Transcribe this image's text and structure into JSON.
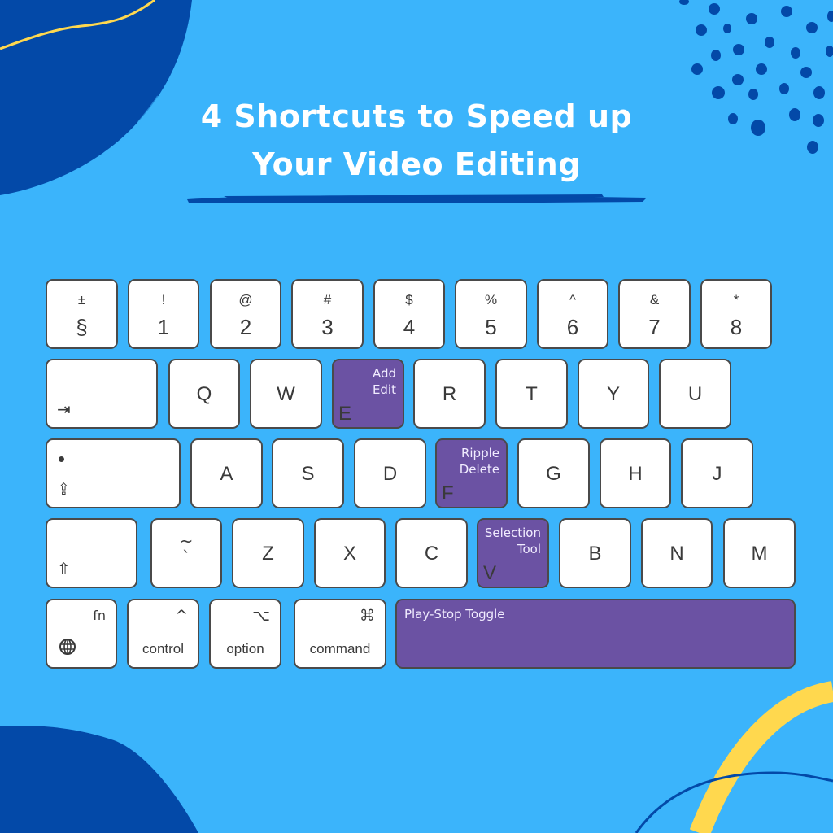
{
  "title": {
    "line1": "4 Shortcuts to Speed up",
    "line2": "Your Video Editing"
  },
  "colors": {
    "background": "#3bb4fb",
    "dark_blue": "#0349a8",
    "yellow": "#ffd84e",
    "highlight_purple": "#6b52a3",
    "key_white": "#ffffff",
    "key_border": "#4a4a4a"
  },
  "keyboard": {
    "number_row": [
      {
        "top": "±",
        "bottom": "§"
      },
      {
        "top": "!",
        "bottom": "1"
      },
      {
        "top": "@",
        "bottom": "2"
      },
      {
        "top": "#",
        "bottom": "3"
      },
      {
        "top": "$",
        "bottom": "4"
      },
      {
        "top": "%",
        "bottom": "5"
      },
      {
        "top": "^",
        "bottom": "6"
      },
      {
        "top": "&",
        "bottom": "7"
      },
      {
        "top": "*",
        "bottom": "8"
      }
    ],
    "tab": {
      "icon": "⇥"
    },
    "qwerty_row": [
      "Q",
      "W",
      "E",
      "R",
      "T",
      "Y",
      "U"
    ],
    "caps": {
      "icon": "⇪"
    },
    "home_row": [
      "A",
      "S",
      "D",
      "F",
      "G",
      "H",
      "J"
    ],
    "shift": {
      "icon": "⇧"
    },
    "tilde_key": {
      "top": "~",
      "bottom": "`"
    },
    "bottom_letter_row": [
      "Z",
      "X",
      "C",
      "V",
      "B",
      "N",
      "M"
    ],
    "modifiers": {
      "fn": {
        "top": "fn",
        "icon": "globe"
      },
      "control": {
        "symbol": "^",
        "label": "control"
      },
      "option": {
        "symbol": "⌥",
        "label": "option"
      },
      "command": {
        "symbol": "⌘",
        "label": "command"
      }
    }
  },
  "shortcuts": {
    "add_edit": {
      "key": "E",
      "label_line1": "Add",
      "label_line2": "Edit"
    },
    "ripple_delete": {
      "key": "F",
      "label_line1": "Ripple",
      "label_line2": "Delete"
    },
    "selection_tool": {
      "key": "V",
      "label_line1": "Selection",
      "label_line2": "Tool"
    },
    "play_stop": {
      "key": "Space",
      "label": "Play-Stop Toggle"
    }
  }
}
